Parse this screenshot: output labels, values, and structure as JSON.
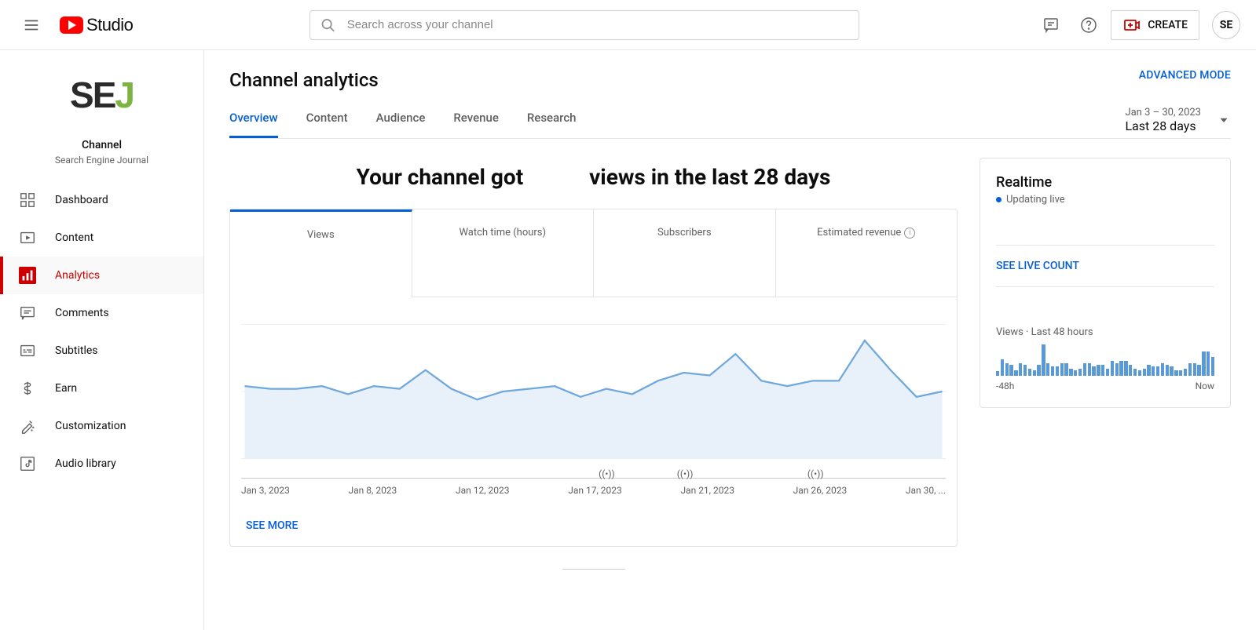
{
  "header": {
    "logo_text": "Studio",
    "search_placeholder": "Search across your channel",
    "create_label": "CREATE",
    "avatar_initials": "SE"
  },
  "sidebar": {
    "channel_label": "Channel",
    "channel_name": "Search Engine Journal",
    "items": [
      {
        "id": "dashboard",
        "label": "Dashboard"
      },
      {
        "id": "content",
        "label": "Content"
      },
      {
        "id": "analytics",
        "label": "Analytics"
      },
      {
        "id": "comments",
        "label": "Comments"
      },
      {
        "id": "subtitles",
        "label": "Subtitles"
      },
      {
        "id": "earn",
        "label": "Earn"
      },
      {
        "id": "customization",
        "label": "Customization"
      },
      {
        "id": "audio-library",
        "label": "Audio library"
      }
    ]
  },
  "page": {
    "title": "Channel analytics",
    "advanced_mode": "ADVANCED MODE",
    "tabs": [
      {
        "label": "Overview"
      },
      {
        "label": "Content"
      },
      {
        "label": "Audience"
      },
      {
        "label": "Revenue"
      },
      {
        "label": "Research"
      }
    ],
    "date_range": "Jan 3 – 30, 2023",
    "date_label": "Last 28 days",
    "headline_prefix": "Your channel got ",
    "headline_suffix": " views in the last 28 days",
    "metric_tabs": [
      {
        "label": "Views"
      },
      {
        "label": "Watch time (hours)"
      },
      {
        "label": "Subscribers"
      },
      {
        "label": "Estimated revenue",
        "has_info": true
      }
    ],
    "see_more": "SEE MORE"
  },
  "realtime": {
    "title": "Realtime",
    "updating": "Updating live",
    "see_live": "SEE LIVE COUNT",
    "views_label": "Views · Last 48 hours",
    "axis_start": "-48h",
    "axis_end": "Now"
  },
  "chart_data": {
    "main_chart": {
      "type": "line",
      "xlabel": "",
      "ylabel": "",
      "x_ticks": [
        "Jan 3, 2023",
        "Jan 8, 2023",
        "Jan 12, 2023",
        "Jan 17, 2023",
        "Jan 21, 2023",
        "Jan 26, 2023",
        "Jan 30, ..."
      ],
      "x": [
        3,
        4,
        5,
        6,
        7,
        8,
        9,
        10,
        11,
        12,
        13,
        14,
        15,
        16,
        17,
        18,
        19,
        20,
        21,
        22,
        23,
        24,
        25,
        26,
        27,
        28,
        29,
        30
      ],
      "values": [
        54,
        52,
        52,
        54,
        48,
        54,
        52,
        66,
        52,
        44,
        50,
        52,
        54,
        46,
        52,
        48,
        58,
        64,
        62,
        78,
        58,
        54,
        58,
        58,
        88,
        66,
        46,
        50
      ],
      "event_markers_x": [
        17,
        20,
        25
      ]
    },
    "realtime_bars": {
      "type": "bar",
      "x_domain": "-48h to Now (48 bins)",
      "values": [
        5,
        18,
        14,
        12,
        6,
        14,
        12,
        8,
        6,
        12,
        34,
        14,
        10,
        10,
        14,
        14,
        8,
        6,
        8,
        14,
        14,
        10,
        12,
        12,
        8,
        16,
        14,
        16,
        16,
        12,
        8,
        6,
        8,
        12,
        10,
        10,
        14,
        12,
        10,
        6,
        6,
        8,
        14,
        14,
        12,
        26,
        26,
        20
      ]
    }
  }
}
